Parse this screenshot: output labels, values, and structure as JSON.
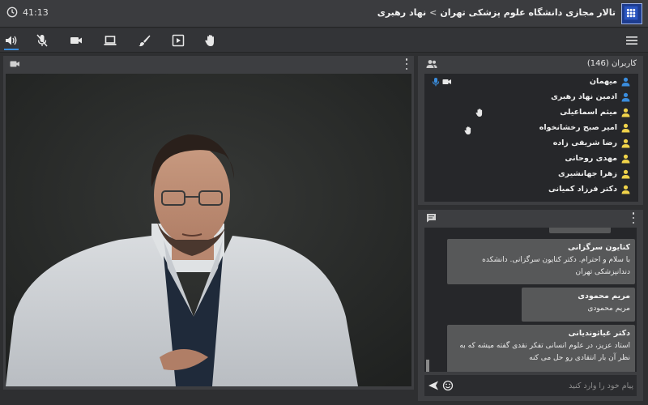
{
  "header": {
    "timer": "41:13",
    "room_name": "تالار مجازی دانشگاه علوم پزشکی تهران",
    "separator": ">",
    "room_sub": "نهاد رهبری"
  },
  "toolbar": {
    "active_tool": "speaker"
  },
  "users": {
    "title": "کاربران (146)",
    "list": [
      {
        "name": "میهمان",
        "color": "#3a8dde",
        "mic": true,
        "cam": true,
        "hand": false
      },
      {
        "name": "ادمین نهاد رهبری",
        "color": "#3a8dde",
        "mic": false,
        "cam": false,
        "hand": false
      },
      {
        "name": "میثم اسماعیلی",
        "color": "#f0d34a",
        "mic": false,
        "cam": false,
        "hand": true
      },
      {
        "name": "امیر صبح رخشانخواه",
        "color": "#f0d34a",
        "mic": false,
        "cam": false,
        "hand": true
      },
      {
        "name": "رضا شریفی زاده",
        "color": "#f0d34a",
        "mic": false,
        "cam": false,
        "hand": false
      },
      {
        "name": "مهدی روحانی",
        "color": "#f0d34a",
        "mic": false,
        "cam": false,
        "hand": false
      },
      {
        "name": "زهرا جهانشیری",
        "color": "#f0d34a",
        "mic": false,
        "cam": false,
        "hand": false
      },
      {
        "name": "دکتر فرزاد کمیانی",
        "color": "#f0d34a",
        "mic": false,
        "cam": false,
        "hand": false
      }
    ]
  },
  "chat": {
    "messages": [
      {
        "sender": "",
        "text": ""
      },
      {
        "sender": "کتایون سرگزانی",
        "text": "با سلام و احترام. دکتر کتایون سرگزانی. دانشکده دندانپزشکی تهران"
      },
      {
        "sender": "مریم محمودی",
        "text": "مریم محمودی"
      },
      {
        "sender": "دکتر غیاثوندیانی",
        "text": "استاد عزیز، در علوم انسانی تفکر نقدی گفته میشه که به نظر آن بار انتقادی رو حل می کنه"
      }
    ],
    "input_placeholder": "پیام خود را وارد کنید"
  },
  "colors": {
    "accent": "#3a8dde",
    "viewer_icon": "#f0d34a",
    "moderator_icon": "#3a8dde"
  }
}
